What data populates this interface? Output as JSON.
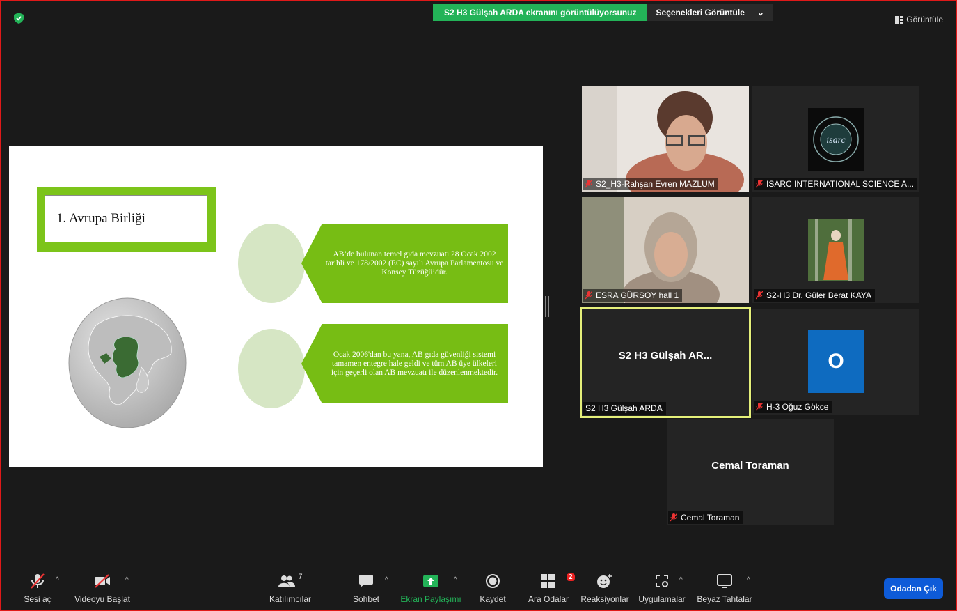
{
  "top": {
    "share_message": "S2 H3 Gülşah ARDA ekranını görüntülüyorsunuz",
    "options_label": "Seçenekleri Görüntüle",
    "view_label": "Görüntüle",
    "accent_green": "#23b358"
  },
  "slide": {
    "title": "1. Avrupa Birliği",
    "box1": "AB’de bulunan temel gıda mevzuatı 28 Ocak 2002 tarihli ve 178/2002 (EC) sayılı Avrupa Parlamentosu ve Konsey Tüzüğü’dür.",
    "box2": "Ocak 2006'dan bu yana, AB gıda güvenliği sistemi tamamen entegre hale geldi ve tüm AB üye ülkeleri için geçerli olan AB mevzuatı ile düzenlenmektedir."
  },
  "participants": {
    "p1": "S2_H3-Rahşan Evren MAZLUM",
    "p2": "ISARC INTERNATIONAL SCIENCE A...",
    "p3": "ESRA GÜRSOY hall 1",
    "p4": "S2-H3 Dr. Güler Berat KAYA",
    "p5_big": "S2 H3 Gülşah AR...",
    "p5": "S2 H3 Gülşah ARDA",
    "p6_initial": "O",
    "p6": "H-3 Oğuz Gökce",
    "p7_big": "Cemal Toraman",
    "p7": "Cemal Toraman"
  },
  "toolbar": {
    "audio": "Sesi aç",
    "video": "Videoyu Başlat",
    "participants": "Katılımcılar",
    "participant_count": "7",
    "chat": "Sohbet",
    "share": "Ekran Paylaşımı",
    "record": "Kaydet",
    "breakout": "Ara Odalar",
    "breakout_badge": "2",
    "reactions": "Reaksiyonlar",
    "apps": "Uygulamalar",
    "whiteboard": "Beyaz Tahtalar",
    "leave": "Odadan Çık"
  }
}
